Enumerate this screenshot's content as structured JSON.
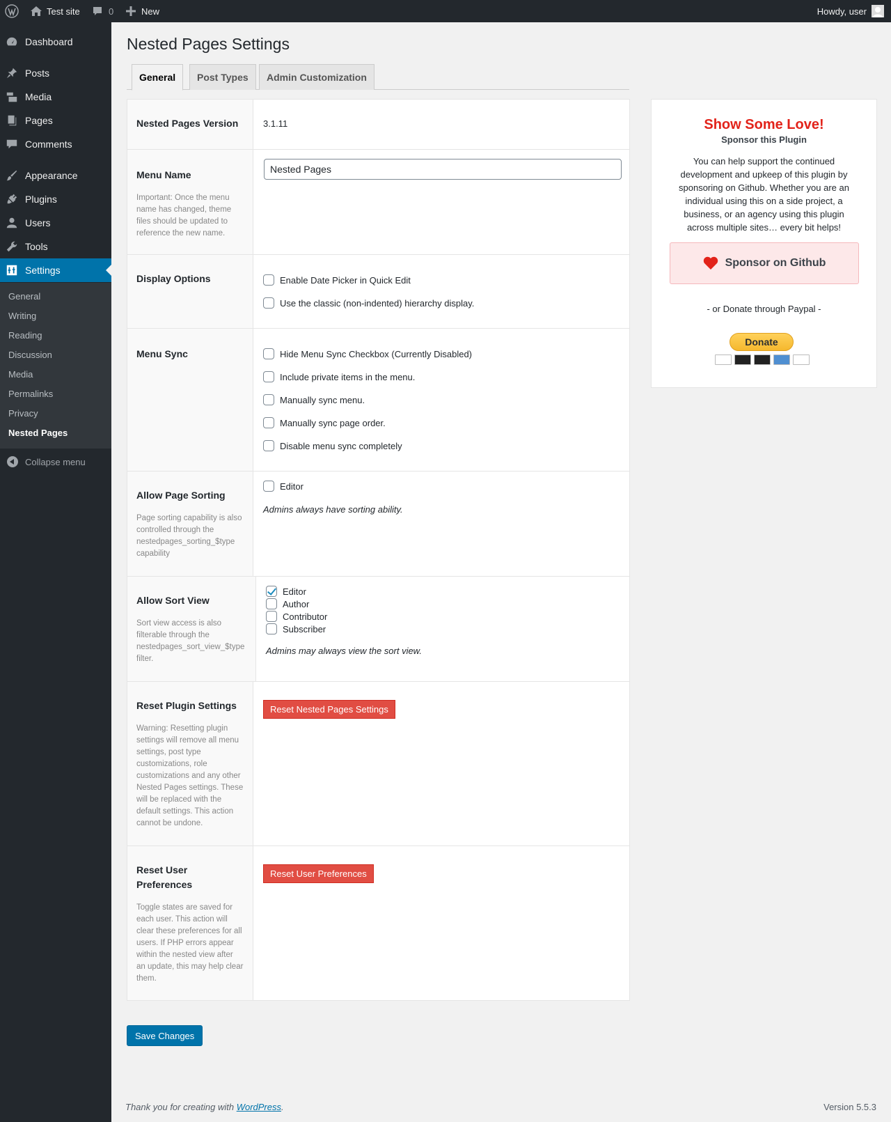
{
  "admin_bar": {
    "site_name": "Test site",
    "comments_count": "0",
    "new_label": "New",
    "howdy": "Howdy, user"
  },
  "sidebar": {
    "items": [
      {
        "label": "Dashboard",
        "icon": "dashboard-icon"
      },
      {
        "label": "Posts",
        "icon": "pin-icon"
      },
      {
        "label": "Media",
        "icon": "media-icon"
      },
      {
        "label": "Pages",
        "icon": "pages-icon"
      },
      {
        "label": "Comments",
        "icon": "comment-icon"
      },
      {
        "label": "Appearance",
        "icon": "brush-icon"
      },
      {
        "label": "Plugins",
        "icon": "plugin-icon"
      },
      {
        "label": "Users",
        "icon": "user-icon"
      },
      {
        "label": "Tools",
        "icon": "wrench-icon"
      },
      {
        "label": "Settings",
        "icon": "settings-icon"
      }
    ],
    "submenu": [
      "General",
      "Writing",
      "Reading",
      "Discussion",
      "Media",
      "Permalinks",
      "Privacy",
      "Nested Pages"
    ],
    "collapse": "Collapse menu"
  },
  "page": {
    "title": "Nested Pages Settings",
    "tabs": [
      "General",
      "Post Types",
      "Admin Customization"
    ]
  },
  "settings": {
    "version": {
      "label": "Nested Pages Version",
      "value": "3.1.11"
    },
    "menu_name": {
      "label": "Menu Name",
      "desc": "Important: Once the menu name has changed, theme files should be updated to reference the new name.",
      "value": "Nested Pages"
    },
    "display": {
      "label": "Display Options",
      "options": [
        "Enable Date Picker in Quick Edit",
        "Use the classic (non-indented) hierarchy display."
      ]
    },
    "menu_sync": {
      "label": "Menu Sync",
      "options": [
        "Hide Menu Sync Checkbox (Currently Disabled)",
        "Include private items in the menu.",
        "Manually sync menu.",
        "Manually sync page order.",
        "Disable menu sync completely"
      ]
    },
    "page_sorting": {
      "label": "Allow Page Sorting",
      "desc": "Page sorting capability is also controlled through the nestedpages_sorting_$type capability",
      "option": "Editor",
      "note": "Admins always have sorting ability."
    },
    "sort_view": {
      "label": "Allow Sort View",
      "desc": "Sort view access is also filterable through the nestedpages_sort_view_$type filter.",
      "options": [
        "Editor",
        "Author",
        "Contributor",
        "Subscriber"
      ],
      "checked": [
        true,
        false,
        false,
        false
      ],
      "note": "Admins may always view the sort view."
    },
    "reset_plugin": {
      "label": "Reset Plugin Settings",
      "desc": "Warning: Resetting plugin settings will remove all menu settings, post type customizations, role customizations and any other Nested Pages settings. These will be replaced with the default settings. This action cannot be undone.",
      "button": "Reset Nested Pages Settings"
    },
    "reset_user": {
      "label": "Reset User Preferences",
      "desc": "Toggle states are saved for each user. This action will clear these preferences for all users. If PHP errors appear within the nested view after an update, this may help clear them.",
      "button": "Reset User Preferences"
    }
  },
  "sponsor": {
    "title": "Show Some Love!",
    "subtitle": "Sponsor this Plugin",
    "text": "You can help support the continued development and upkeep of this plugin by sponsoring on Github. Whether you are an individual using this on a side project, a business, or an agency using this plugin across multiple sites… every bit helps!",
    "github_button": "Sponsor on Github",
    "or_text": "- or Donate through Paypal -",
    "donate_button": "Donate"
  },
  "save_button": "Save Changes",
  "footer": {
    "thank_you": "Thank you for creating with ",
    "link": "WordPress",
    "period": ".",
    "version": "Version 5.5.3"
  },
  "colors": {
    "accent": "#0073aa",
    "danger": "#e14d43",
    "sponsor_title": "#e2231a"
  }
}
